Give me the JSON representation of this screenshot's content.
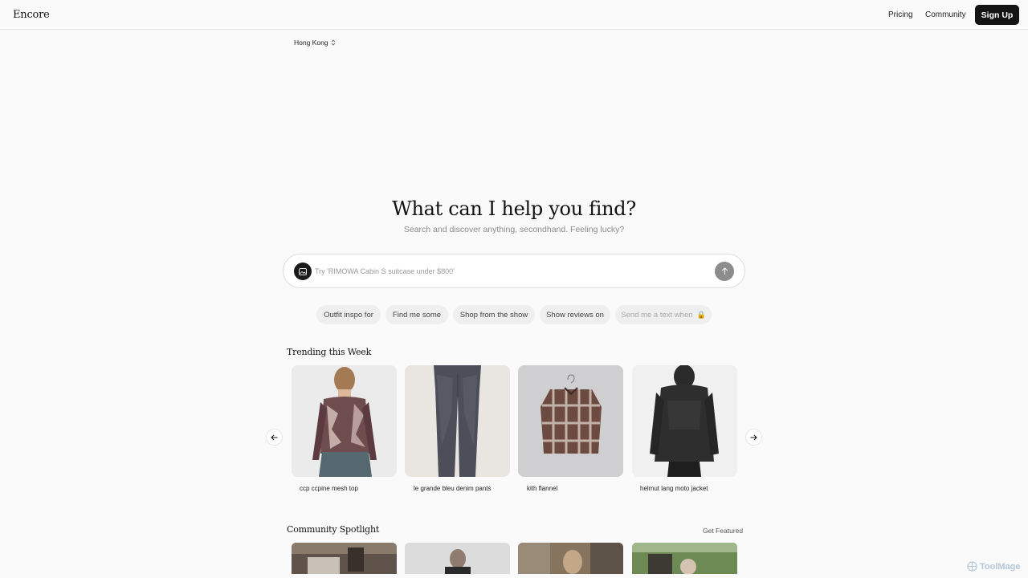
{
  "header": {
    "logo": "Encore",
    "nav": [
      "Pricing",
      "Community"
    ],
    "signup_label": "Sign Up"
  },
  "location": {
    "label": "Hong Kong"
  },
  "hero": {
    "title": "What can I help you find?",
    "subtitle": "Search and discover anything, secondhand. Feeling lucky?"
  },
  "search": {
    "placeholder": "Try 'RIMOWA Cabin S suitcase under $800'",
    "value": ""
  },
  "chips": [
    {
      "label": "Outfit inspo for"
    },
    {
      "label": "Find me some"
    },
    {
      "label": "Shop from the show"
    },
    {
      "label": "Show reviews on"
    },
    {
      "label": "Send me a text when",
      "locked": true
    }
  ],
  "trending": {
    "title": "Trending this Week",
    "items": [
      {
        "caption": "ccp ccpine mesh top"
      },
      {
        "caption": "le grande bleu denim pants"
      },
      {
        "caption": "kith flannel"
      },
      {
        "caption": "helmut lang moto jacket"
      }
    ]
  },
  "community": {
    "title": "Community Spotlight",
    "action": "Get Featured"
  },
  "watermark": "ToolMage",
  "icons": {
    "chevron": "chevron-updown-icon",
    "image_upload": "image-icon",
    "send": "arrow-up-icon",
    "lock": "lock-icon",
    "prev": "arrow-left-icon",
    "next": "arrow-right-icon"
  }
}
